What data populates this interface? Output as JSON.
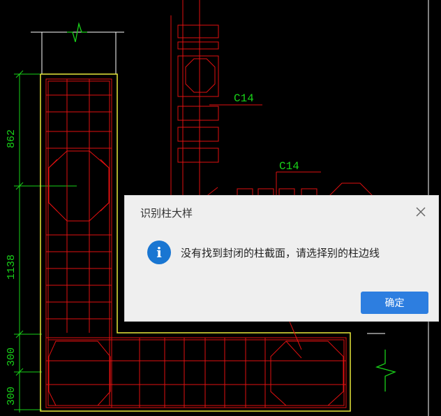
{
  "drawing": {
    "dimensions": [
      "862",
      "1138",
      "300",
      "300"
    ],
    "column_tags": [
      "C14",
      "C14"
    ],
    "colors": {
      "rebar": "#e01010",
      "outline": "#e8e83a",
      "dimension": "#19d219",
      "frame": "#ffffff"
    }
  },
  "dialog": {
    "title": "识别柱大样",
    "message": "没有找到封闭的柱截面，请选择别的柱边线",
    "ok_label": "确定",
    "icon": "info-icon",
    "close_icon": "close-icon",
    "accent": "#2d7ee0"
  }
}
